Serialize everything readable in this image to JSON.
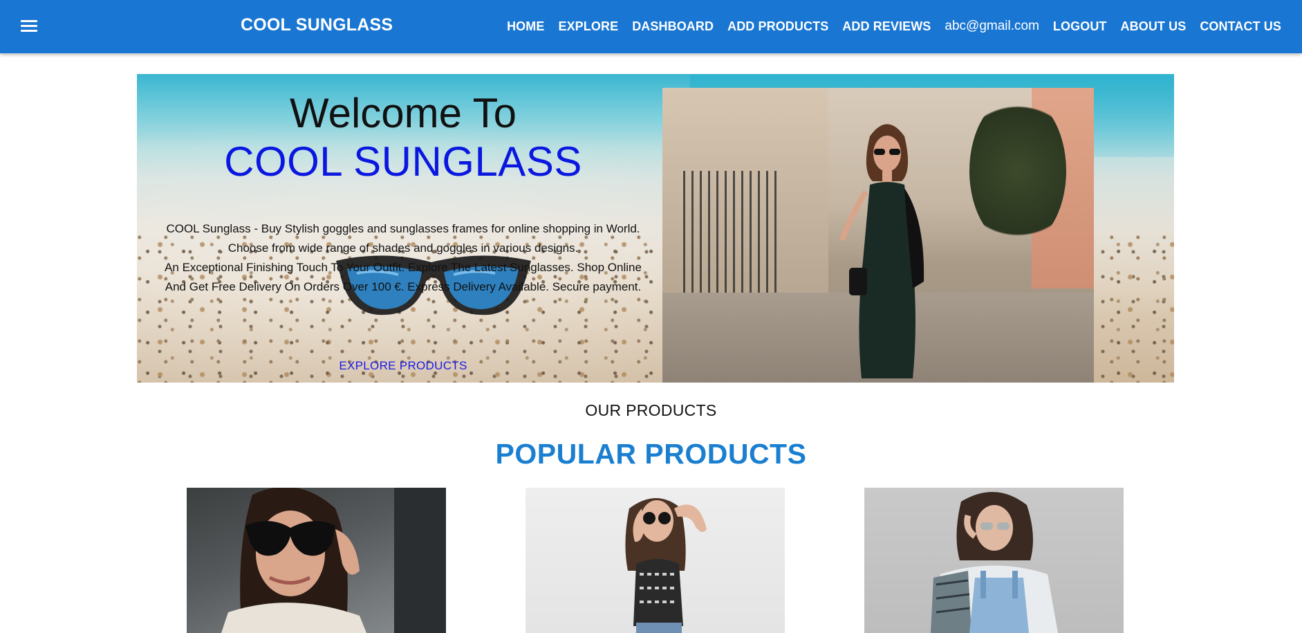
{
  "header": {
    "brand": "COOL SUNGLASS",
    "nav": [
      "HOME",
      "EXPLORE",
      "DASHBOARD",
      "ADD PRODUCTS",
      "ADD REVIEWS"
    ],
    "user_email": "abc@gmail.com",
    "nav_right": [
      "LOGOUT",
      "ABOUT US",
      "CONTACT US"
    ],
    "color": "#1976d2"
  },
  "hero": {
    "welcome": "Welcome To",
    "brand": "COOL SUNGLASS",
    "description_1": "COOL Sunglass - Buy Stylish goggles and sunglasses frames for online shopping in World. Choose from wide range of shades and goggles in various designs.",
    "description_2": "An Exceptional Finishing Touch To Your Outfit. Explore The Latest Sunglasses. Shop Online And Get Free Delivery On Orders Over 100 €. Express Delivery Available. Secure payment.",
    "cta": "EXPLORE PRODUCTS"
  },
  "products": {
    "section_label": "OUR PRODUCTS",
    "heading": "POPULAR PRODUCTS",
    "heading_color": "#1a7fd0"
  }
}
